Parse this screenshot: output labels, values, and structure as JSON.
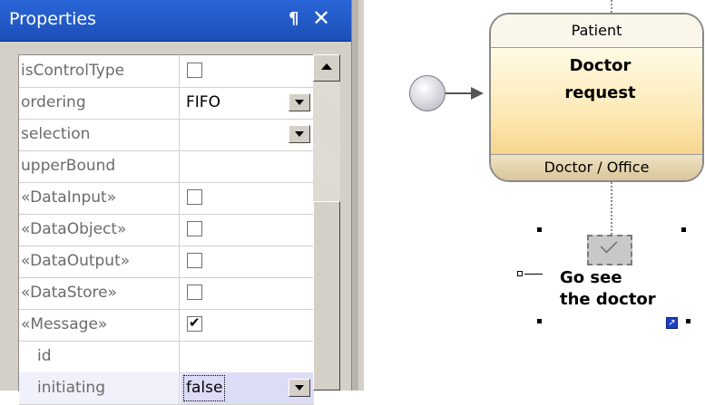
{
  "panel": {
    "title": "Properties",
    "pin_glyph": "¶",
    "close_glyph": "✕"
  },
  "properties": [
    {
      "name": "isControlType",
      "type": "checkbox",
      "checked": false
    },
    {
      "name": "ordering",
      "type": "dropdown",
      "value": "FIFO"
    },
    {
      "name": "selection",
      "type": "dropdown",
      "value": ""
    },
    {
      "name": "upperBound",
      "type": "text",
      "value": ""
    },
    {
      "name": "«DataInput»",
      "type": "checkbox",
      "checked": false
    },
    {
      "name": "«DataObject»",
      "type": "checkbox",
      "checked": false
    },
    {
      "name": "«DataOutput»",
      "type": "checkbox",
      "checked": false
    },
    {
      "name": "«DataStore»",
      "type": "checkbox",
      "checked": false
    },
    {
      "name": "«Message»",
      "type": "checkbox",
      "checked": true
    },
    {
      "name": "id",
      "type": "text",
      "value": "",
      "indent": true
    },
    {
      "name": "initiating",
      "type": "dropdown",
      "value": "false",
      "indent": true,
      "selected": true
    }
  ],
  "diagram": {
    "task": {
      "top_label": "Patient",
      "name_line1": "Doctor",
      "name_line2": "request",
      "bottom_label": "Doctor / Office"
    },
    "message": {
      "label_line1": "Go see",
      "label_line2": "the doctor",
      "link_glyph": "↗"
    }
  },
  "colors": {
    "title_bar": "#1c4fb8",
    "selection_row": "#dcdcf6",
    "task_fill": "#fde9b5"
  }
}
